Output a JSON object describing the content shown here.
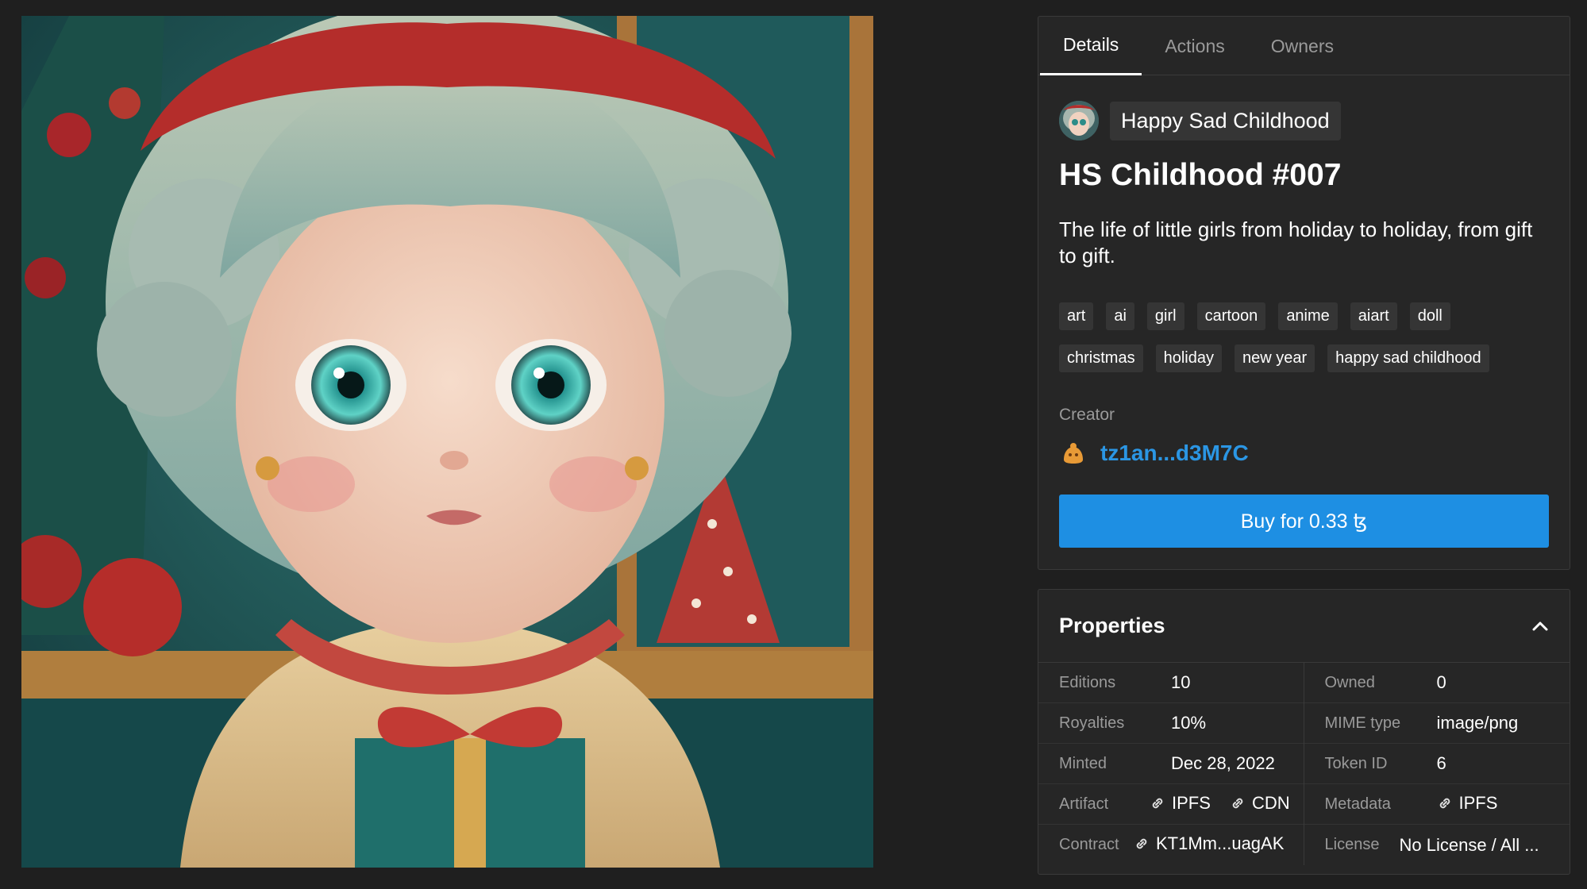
{
  "artwork": {
    "image_alt": "cartoon girl with teal curly hair and red bow holding gift"
  },
  "tabs": [
    {
      "label": "Details",
      "active": true
    },
    {
      "label": "Actions",
      "active": false
    },
    {
      "label": "Owners",
      "active": false
    }
  ],
  "collection": {
    "name": "Happy Sad Childhood"
  },
  "token": {
    "title": "HS Childhood #007",
    "description": "The life of little girls from holiday to holiday, from gift to gift."
  },
  "tags": [
    "art",
    "ai",
    "girl",
    "cartoon",
    "anime",
    "aiart",
    "doll",
    "christmas",
    "holiday",
    "new year",
    "happy sad childhood"
  ],
  "creator": {
    "label": "Creator",
    "address": "tz1an...d3M7C"
  },
  "buy_button": {
    "label": "Buy for 0.33 ꜩ"
  },
  "properties": {
    "title": "Properties",
    "editions": {
      "label": "Editions",
      "value": "10"
    },
    "owned": {
      "label": "Owned",
      "value": "0"
    },
    "royalties": {
      "label": "Royalties",
      "value": "10%"
    },
    "mime": {
      "label": "MIME type",
      "value": "image/png"
    },
    "minted": {
      "label": "Minted",
      "value": "Dec 28, 2022"
    },
    "token_id": {
      "label": "Token ID",
      "value": "6"
    },
    "artifact": {
      "label": "Artifact",
      "link1": "IPFS",
      "link2": "CDN"
    },
    "metadata": {
      "label": "Metadata",
      "link": "IPFS"
    },
    "contract": {
      "label": "Contract",
      "value": "KT1Mm...uagAK"
    },
    "license": {
      "label": "License",
      "value": "No License / All ..."
    }
  },
  "colors": {
    "accent": "#1e8fe3",
    "link": "#2b96e4",
    "panel": "#262626",
    "background": "#1f1f1f"
  }
}
